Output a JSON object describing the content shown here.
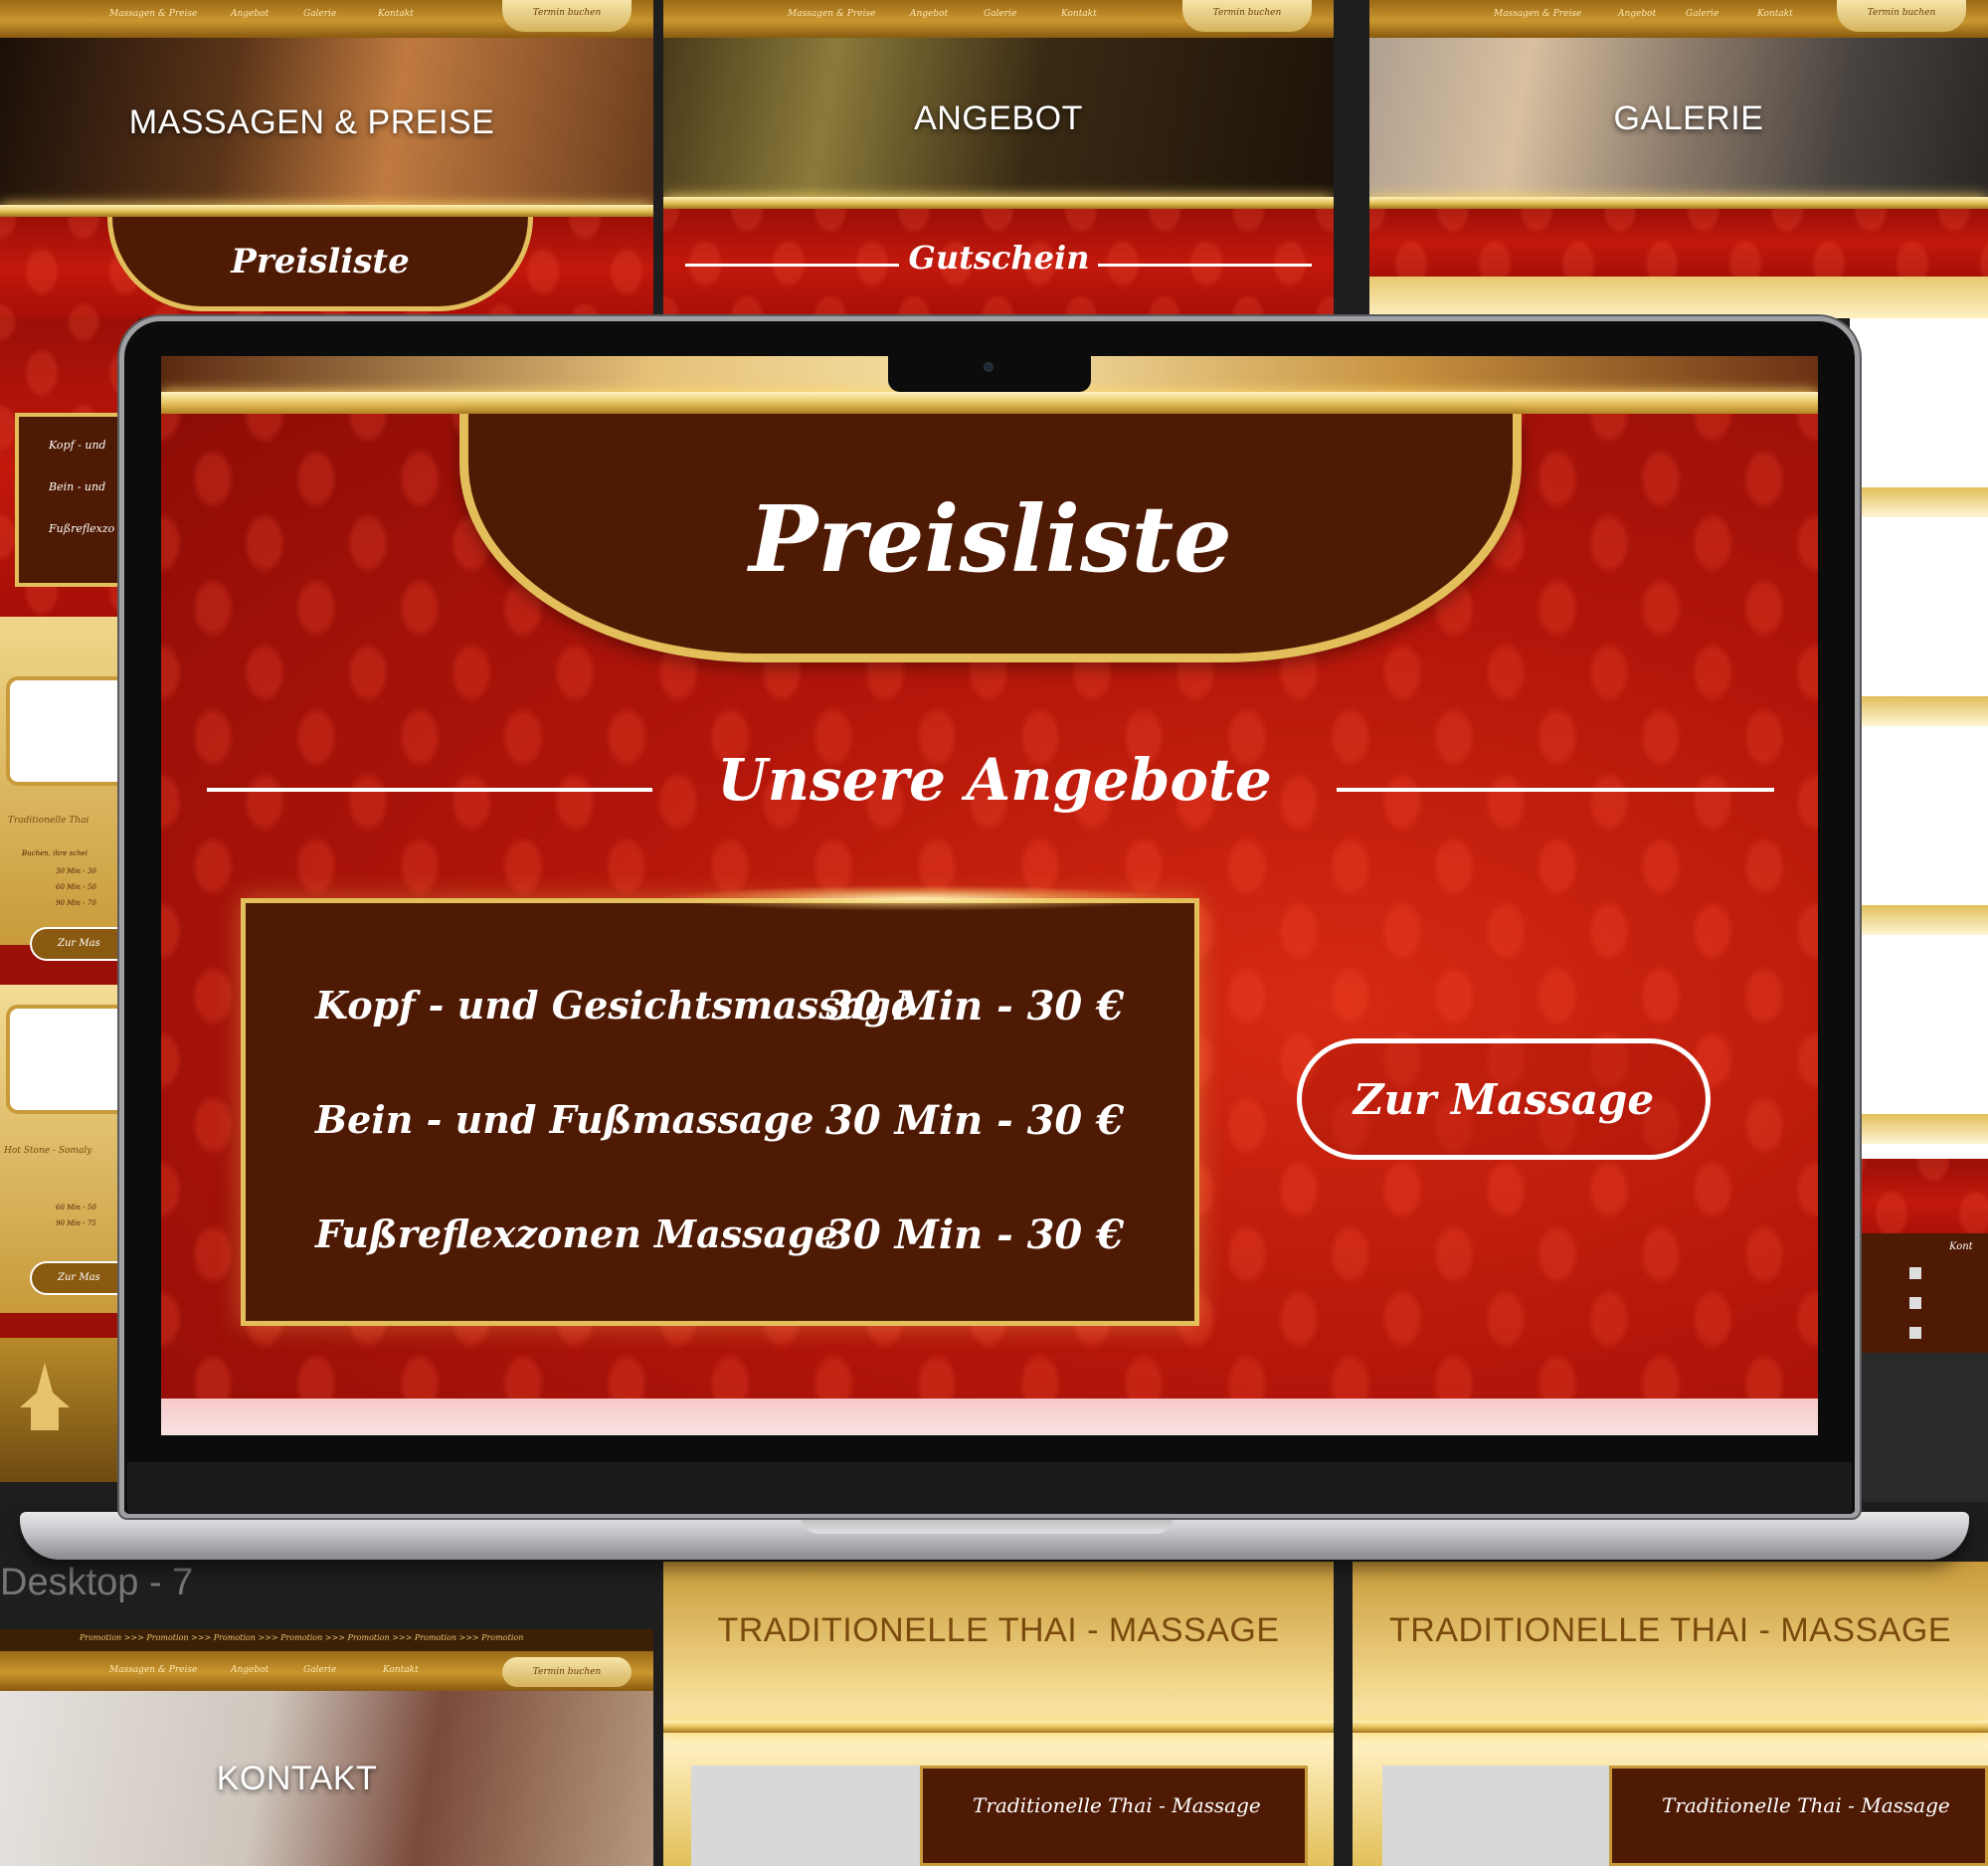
{
  "mockups": {
    "massagen": {
      "nav": [
        "Massagen & Preise",
        "Angebot",
        "Galerie",
        "Kontakt"
      ],
      "nav_cta": "Termin buchen",
      "hero": "MASSAGEN & PREISE",
      "tab": "Preisliste",
      "side_items": [
        "Kopf - und",
        "Bein - und",
        "Fußreflexzo"
      ]
    },
    "angebot": {
      "nav": [
        "Massagen & Preise",
        "Angebot",
        "Galerie",
        "Kontakt"
      ],
      "nav_cta": "Termin buchen",
      "hero": "ANGEBOT",
      "section": "Gutschein"
    },
    "galerie": {
      "nav": [
        "Massagen & Preise",
        "Angebot",
        "Galerie",
        "Kontakt"
      ],
      "nav_cta": "Termin buchen",
      "hero": "GALERIE"
    },
    "left_cards": {
      "card1_title": "Traditionelle Thai",
      "card1_lines": [
        "Buchen, ihre schei",
        "30 Min - 30",
        "60 Min - 50",
        "90 Min - 70"
      ],
      "card1_btn": "Zur Mas",
      "card2_title": "Hot Stone - Somaly",
      "card2_lines": [
        "60 Min - 50",
        "90 Min - 75"
      ],
      "card2_btn": "Zur Mas"
    },
    "desktop_label": "Desktop - 7",
    "kontakt": {
      "nav": [
        "Massagen & Preise",
        "Angebot",
        "Galerie",
        "Kontakt"
      ],
      "nav_cta": "Termin buchen",
      "ticker": "Promotion >>> Promotion >>> Promotion >>> Promotion >>> Promotion >>> Promotion >>> Promotion",
      "hero": "KONTAKT"
    },
    "thai1": {
      "title": "TRADITIONELLE THAI - MASSAGE",
      "card": "Traditionelle Thai - Massage"
    },
    "thai2": {
      "title": "TRADITIONELLE THAI - MASSAGE",
      "card": "Traditionelle Thai - Massage"
    },
    "right_side": {
      "heading": "Kont"
    }
  },
  "screen": {
    "tab_title": "Preisliste",
    "section_title": "Unsere Angebote",
    "prices": [
      {
        "name": "Kopf - und Gesichtsmassage",
        "price": "30 Min - 30 €"
      },
      {
        "name": "Bein - und Fußmassage",
        "price": "30 Min - 30 €"
      },
      {
        "name": "Fußreflexzonen Massage",
        "price": "30 Min - 30 €"
      }
    ],
    "cta_button": "Zur Massage"
  },
  "colors": {
    "red": "#b5150a",
    "brown": "#4e1a04",
    "gold": "#e2bf5a",
    "white": "#ffffff"
  }
}
